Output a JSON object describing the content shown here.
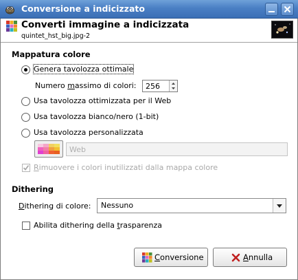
{
  "window": {
    "title": "Conversione a indicizzato",
    "accent_color": "#4a7fc4"
  },
  "header": {
    "title": "Converti immagine a indicizzata",
    "subtitle": "quintet_hst_big.jpg-2"
  },
  "colormap": {
    "section_title": "Mappatura colore",
    "options": [
      {
        "label": "Genera tavolozza ottimale",
        "selected": true
      },
      {
        "label": "Usa tavolozza ottimizzata per il Web",
        "selected": false
      },
      {
        "label": "Usa tavolozza bianco/nero (1-bit)",
        "selected": false
      },
      {
        "label": "Usa tavolozza personalizzata",
        "selected": false
      }
    ],
    "max_colors": {
      "label_before": "Numero ",
      "label_mnemonic": "m",
      "label_after": "assimo di colori:",
      "value": "256"
    },
    "custom_palette": {
      "value": "Web"
    },
    "remove_unused": {
      "label_mnemonic": "R",
      "label_after": "imuovere i colori inutilizzati dalla mappa colore",
      "checked": true,
      "enabled": false
    }
  },
  "dithering": {
    "section_title": "Dithering",
    "color_label": {
      "mnemonic": "D",
      "after": "ithering di colore:"
    },
    "color_value": "Nessuno",
    "transparency": {
      "before": "Abilita dithering della ",
      "mnemonic": "t",
      "after": "rasparenza",
      "checked": false
    }
  },
  "buttons": {
    "convert": {
      "mnemonic": "C",
      "after": "onversione"
    },
    "cancel": {
      "mnemonic": "A",
      "after": "nnulla"
    }
  }
}
